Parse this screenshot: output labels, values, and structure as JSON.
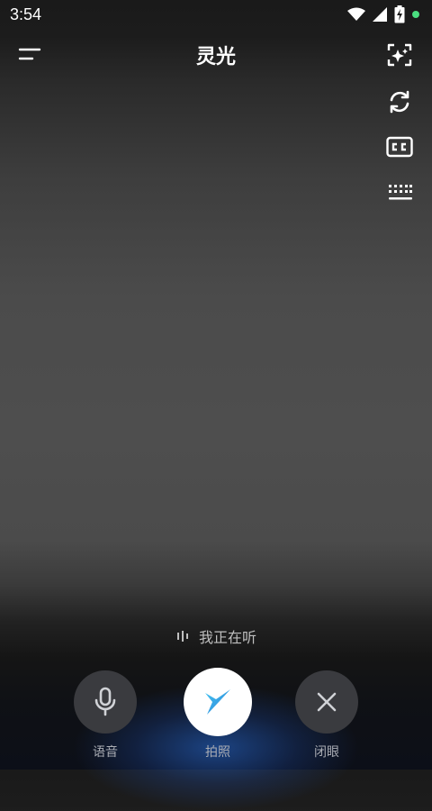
{
  "status_bar": {
    "time": "3:54"
  },
  "header": {
    "title": "灵光"
  },
  "tools": [
    "sparkle-frame-icon",
    "refresh-icon",
    "cc-icon",
    "keyboard-icon"
  ],
  "listening_text": "我正在听",
  "controls": {
    "voice_label": "语音",
    "photo_label": "拍照",
    "close_label": "闭眼"
  },
  "colors": {
    "status_dot": "#4ade80",
    "accent_star": "#3fb0e6"
  }
}
